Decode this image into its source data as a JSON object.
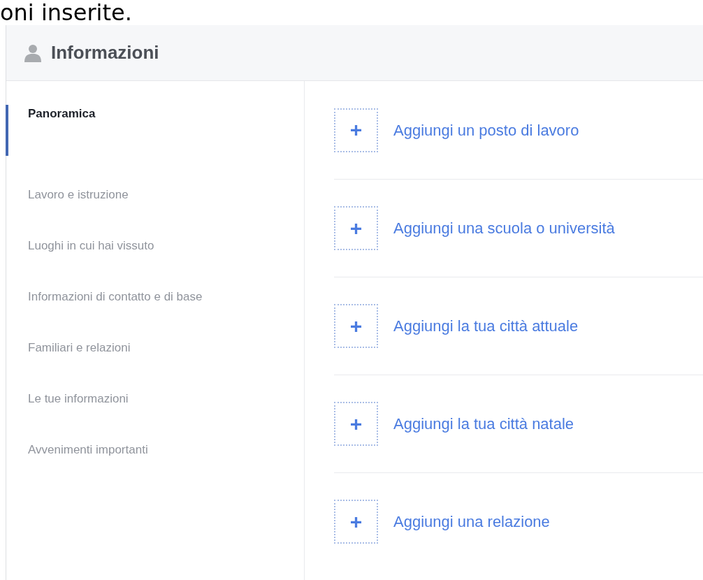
{
  "caption": "oni inserite.",
  "header": {
    "title": "Informazioni"
  },
  "sidebar": {
    "items": [
      {
        "label": "Panoramica",
        "selected": true
      },
      {
        "label": "Lavoro e istruzione",
        "selected": false
      },
      {
        "label": "Luoghi in cui hai vissuto",
        "selected": false
      },
      {
        "label": "Informazioni di contatto e di base",
        "selected": false
      },
      {
        "label": "Familiari e relazioni",
        "selected": false
      },
      {
        "label": "Le tue informazioni",
        "selected": false
      },
      {
        "label": "Avvenimenti importanti",
        "selected": false
      }
    ]
  },
  "actions": [
    {
      "plus": "+",
      "label": "Aggiungi un posto di lavoro"
    },
    {
      "plus": "+",
      "label": "Aggiungi una scuola o università"
    },
    {
      "plus": "+",
      "label": "Aggiungi la tua città attuale"
    },
    {
      "plus": "+",
      "label": "Aggiungi la tua città natale"
    },
    {
      "plus": "+",
      "label": "Aggiungi una relazione"
    }
  ]
}
